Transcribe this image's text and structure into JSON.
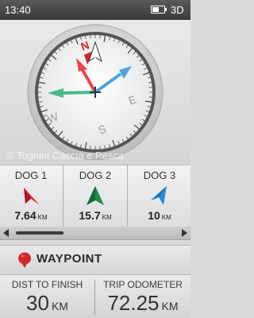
{
  "status_bar": {
    "time": "13:40",
    "battery_level": 0.6,
    "mode": "3D"
  },
  "compass": {
    "cardinals": {
      "north": "N",
      "east": "E",
      "south": "S",
      "west": "W"
    },
    "colors": {
      "north_marker": "#d2232a",
      "dog1": "#e8474c",
      "dog3": "#4fa3e0",
      "waypoint": "#4bb88b"
    }
  },
  "watermark": "© Tognini Caccia e Pesca",
  "dogs": [
    {
      "name": "DOG 1",
      "distance": "7.64",
      "unit": "KM",
      "color": "#d9262b"
    },
    {
      "name": "DOG 2",
      "distance": "15.7",
      "unit": "KM",
      "color": "#1e8a4a"
    },
    {
      "name": "DOG 3",
      "distance": "10",
      "unit": "KM",
      "color": "#2a8ad6"
    }
  ],
  "waypoint": {
    "label": "WAYPOINT",
    "color": "#d9262b"
  },
  "stats": {
    "dist_to_finish": {
      "title": "DIST TO FINISH",
      "value": "30",
      "unit": "KM"
    },
    "trip_odometer": {
      "title": "TRIP ODOMETER",
      "value": "72.25",
      "unit": "KM"
    }
  }
}
